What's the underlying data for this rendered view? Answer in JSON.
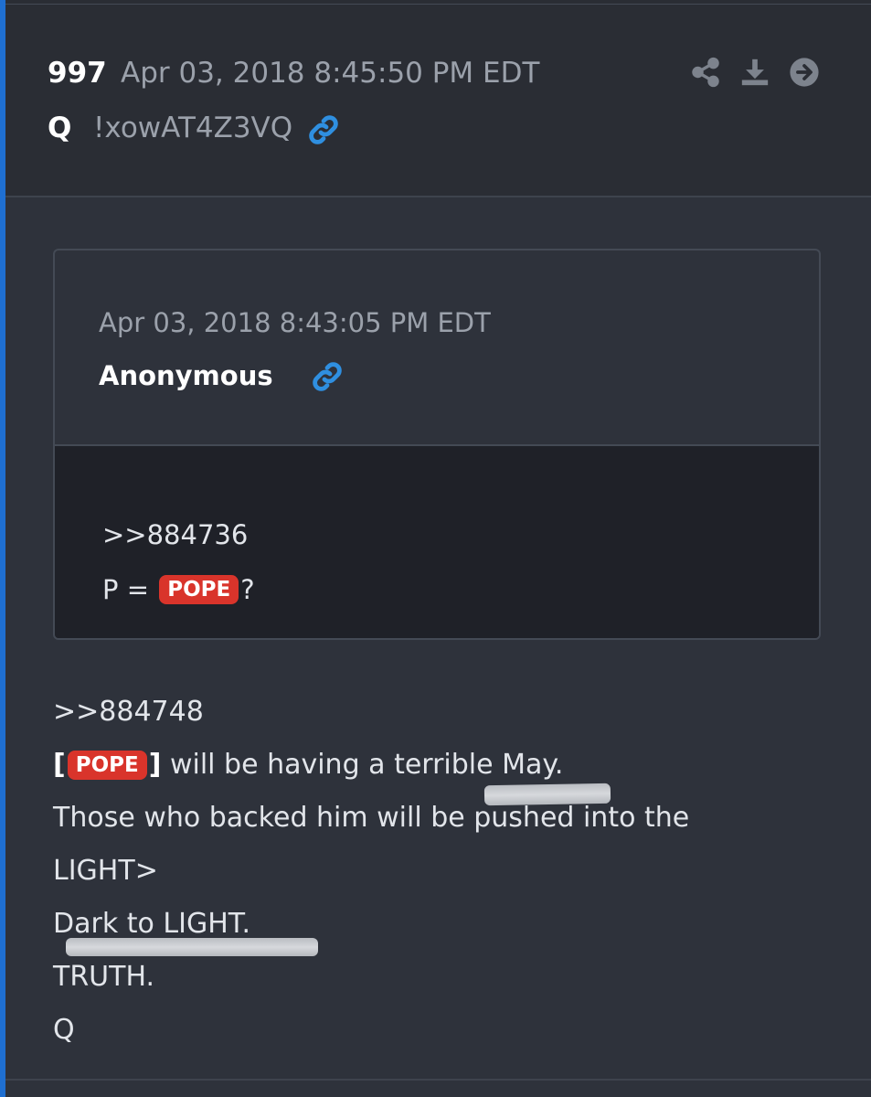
{
  "post": {
    "number": "997",
    "timestamp": "Apr 03, 2018 8:45:50 PM EDT",
    "author": "Q",
    "tripcode": "!xowAT4Z3VQ",
    "actions": {
      "share_icon": "share-icon",
      "download_icon": "download-icon",
      "goto_icon": "arrow-right-circle-icon"
    }
  },
  "quoted_post": {
    "timestamp": "Apr 03, 2018 8:43:05 PM EDT",
    "author": "Anonymous",
    "reference": ">>884736",
    "line_prefix": "P = ",
    "badge": "POPE",
    "line_suffix": "?"
  },
  "body": {
    "reference": ">>884748",
    "bracket_open": "[",
    "badge": "POPE",
    "bracket_close": "]",
    "line1_rest": " will be having a terrible May.",
    "line2": "Those who backed him will be pushed into the",
    "line3": "LIGHT>",
    "line4": "Dark to LIGHT.",
    "line5": "TRUTH.",
    "signature": "Q"
  },
  "colors": {
    "accent": "#1f6fd1",
    "badge": "#d9342b",
    "link_icon": "#2f8fe0"
  }
}
